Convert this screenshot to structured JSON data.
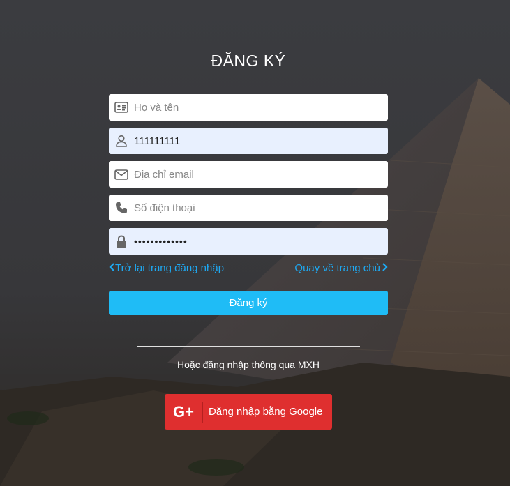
{
  "page": {
    "title": "ĐĂNG KÝ"
  },
  "form": {
    "fullname": {
      "placeholder": "Họ và tên",
      "value": "",
      "icon": "id-card-icon"
    },
    "username": {
      "placeholder": "",
      "value": "111111111",
      "icon": "user-icon"
    },
    "email": {
      "placeholder": "Địa chỉ email",
      "value": "",
      "icon": "envelope-icon"
    },
    "phone": {
      "placeholder": "Số điện thoại",
      "value": "",
      "icon": "phone-icon"
    },
    "password": {
      "value": "•••••••••••••",
      "icon": "lock-icon"
    },
    "back_to_login": "Trở lại trang đăng nhập",
    "back_home": "Quay về trang chủ",
    "submit_label": "Đăng ký"
  },
  "social": {
    "heading": "Hoặc đăng nhập thông qua MXH",
    "google_icon": "G+",
    "google_label": "Đăng nhập bằng Google"
  },
  "colors": {
    "accent": "#1fbcf6",
    "link": "#1ea9f2",
    "google": "#df2f2f",
    "filled_field": "#e8f0fe"
  }
}
